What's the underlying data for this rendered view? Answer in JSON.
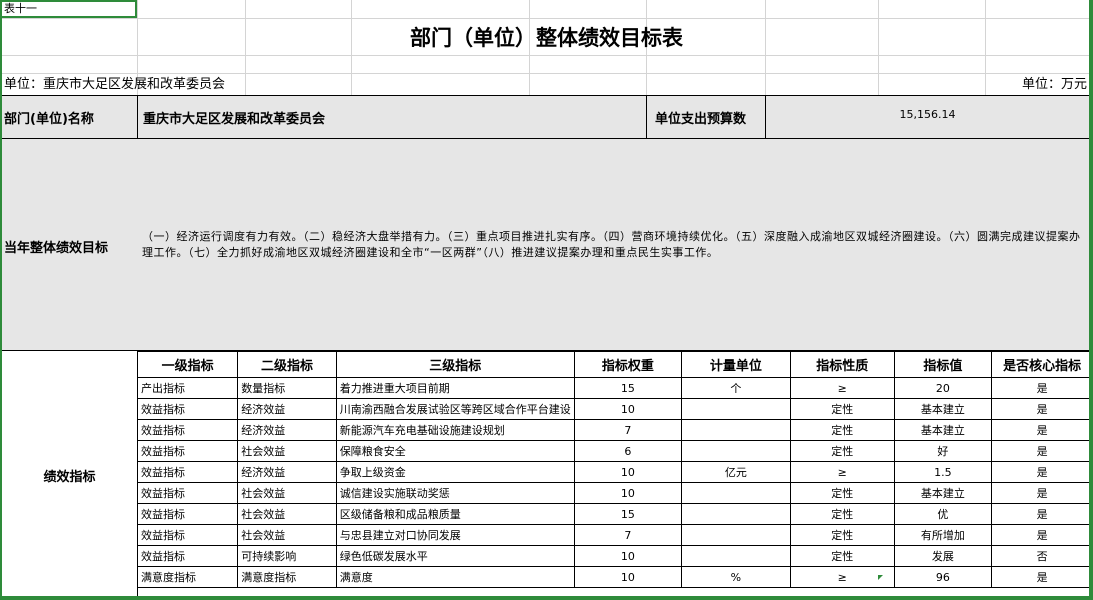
{
  "sheet": {
    "selected_cell": "表十一",
    "title": "部门（单位）整体绩效目标表",
    "unit_org": "单位：重庆市大足区发展和改革委员会",
    "unit_currency": "单位：万元"
  },
  "info": {
    "name_label": "部门(单位)名称",
    "name_value": "重庆市大足区发展和改革委员会",
    "budget_label": "单位支出预算数",
    "budget_value": "15,156.14"
  },
  "goal": {
    "label": "当年整体绩效目标",
    "text": "（一）经济运行调度有力有效。（二）稳经济大盘举措有力。（三）重点项目推进扎实有序。（四）营商环境持续优化。（五）深度融入成渝地区双城经济圈建设。（六）圆满完成建议提案办理工作。（七）全力抓好成渝地区双城经济圈建设和全市“一区两群”（八）推进建议提案办理和重点民生实事工作。"
  },
  "performance": {
    "label": "绩效指标",
    "headers": [
      "一级指标",
      "二级指标",
      "三级指标",
      "指标权重",
      "计量单位",
      "指标性质",
      "指标值",
      "是否核心指标"
    ],
    "rows": [
      [
        "产出指标",
        "数量指标",
        "着力推进重大项目前期",
        "15",
        "个",
        "≥",
        "20",
        "是"
      ],
      [
        "效益指标",
        "经济效益",
        "川南渝西融合发展试验区等跨区域合作平台建设",
        "10",
        "",
        "定性",
        "基本建立",
        "是"
      ],
      [
        "效益指标",
        "经济效益",
        "新能源汽车充电基础设施建设规划",
        "7",
        "",
        "定性",
        "基本建立",
        "是"
      ],
      [
        "效益指标",
        "社会效益",
        "保障粮食安全",
        "6",
        "",
        "定性",
        "好",
        "是"
      ],
      [
        "效益指标",
        "经济效益",
        "争取上级资金",
        "10",
        "亿元",
        "≥",
        "1.5",
        "是"
      ],
      [
        "效益指标",
        "社会效益",
        "诚信建设实施联动奖惩",
        "10",
        "",
        "定性",
        "基本建立",
        "是"
      ],
      [
        "效益指标",
        "社会效益",
        "区级储备粮和成品粮质量",
        "15",
        "",
        "定性",
        "优",
        "是"
      ],
      [
        "效益指标",
        "社会效益",
        "与忠县建立对口协同发展",
        "7",
        "",
        "定性",
        "有所增加",
        "是"
      ],
      [
        "效益指标",
        "可持续影响",
        "绿色低碳发展水平",
        "10",
        "",
        "定性",
        "发展",
        "否"
      ],
      [
        "满意度指标",
        "满意度指标",
        "满意度",
        "10",
        "%",
        "≥",
        "96",
        "是"
      ]
    ]
  }
}
